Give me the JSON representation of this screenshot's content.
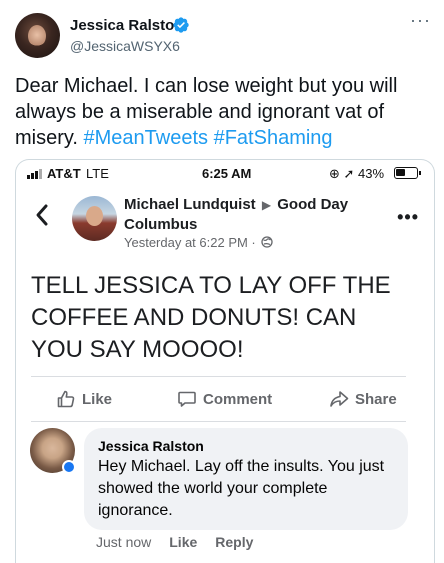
{
  "tweet": {
    "author_name": "Jessica Ralston",
    "author_handle": "@JessicaWSYX6",
    "text_plain": "Dear Michael. I can lose weight but you will always be a miserable and ignorant vat of misery. ",
    "hashtags": [
      "#MeanTweets",
      "#FatShaming"
    ],
    "accent_color": "#1d9bf0"
  },
  "phone_status": {
    "carrier": "AT&T",
    "network": "LTE",
    "time": "6:25 AM",
    "battery": "43%"
  },
  "fb_post": {
    "author": "Michael Lundquist",
    "group": "Good Day Columbus",
    "timestamp": "Yesterday at 6:22 PM ·",
    "text": "TELL JESSICA TO LAY OFF THE COFFEE AND DONUTS!  CAN YOU  SAY MOOOO!",
    "actions": {
      "like": "Like",
      "comment": "Comment",
      "share": "Share"
    }
  },
  "fb_comment": {
    "author": "Jessica Ralston",
    "text": "Hey Michael. Lay off the insults. You just showed the world your complete ignorance.",
    "time": "Just now",
    "like": "Like",
    "reply": "Reply"
  },
  "icons": {
    "verified": "verified-badge-icon",
    "more": "more-icon",
    "back": "chevron-left-icon",
    "globe": "globe-icon",
    "like": "thumbs-up-icon",
    "comment": "comment-icon",
    "share": "share-icon"
  }
}
